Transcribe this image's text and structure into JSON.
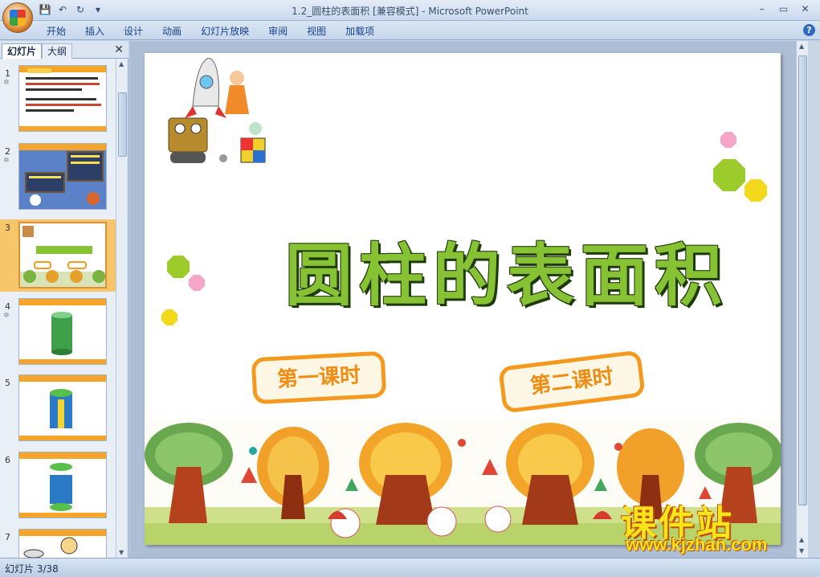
{
  "window": {
    "title": "1.2_圆柱的表面积 [兼容模式] - Microsoft PowerPoint",
    "controls": [
      "–",
      "▭",
      "✕"
    ]
  },
  "quick_access": [
    "save-icon",
    "undo-icon",
    "redo-icon",
    "customize-icon"
  ],
  "ribbon": {
    "tabs": [
      "开始",
      "插入",
      "设计",
      "动画",
      "幻灯片放映",
      "审阅",
      "视图",
      "加载项"
    ],
    "help": "?"
  },
  "left_panel": {
    "tabs": [
      "幻灯片",
      "大纲"
    ],
    "close": "✕",
    "thumbnails": [
      {
        "number": "1",
        "star": "✲"
      },
      {
        "number": "2",
        "star": "✲"
      },
      {
        "number": "3",
        "star": "",
        "selected": true
      },
      {
        "number": "4",
        "star": "✲"
      },
      {
        "number": "5",
        "star": ""
      },
      {
        "number": "6",
        "star": ""
      },
      {
        "number": "7",
        "star": ""
      }
    ]
  },
  "slide": {
    "title": "圆柱的表面积",
    "lesson_one": "第一课时",
    "lesson_two": "第二课时"
  },
  "watermark": {
    "name": "课件站",
    "url": "www.kjzhan.com"
  },
  "status": {
    "slide_info": "幻灯片 3/38"
  },
  "colors": {
    "title_green": "#86c233",
    "lesson_orange": "#f39a1e",
    "selected_thumb": "#f7c66b"
  }
}
